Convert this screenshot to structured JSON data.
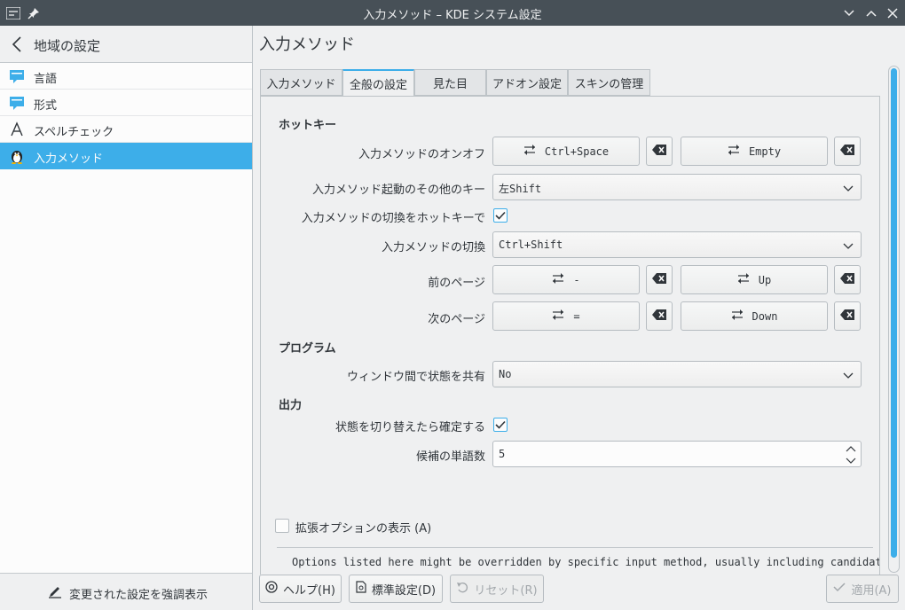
{
  "window": {
    "title": "入力メソッド – KDE システム設定"
  },
  "sidebar": {
    "header": "地域の設定",
    "items": [
      {
        "label": "言語",
        "icon": "speech-bubble-icon"
      },
      {
        "label": "形式",
        "icon": "speech-bubble-icon"
      },
      {
        "label": "スペルチェック",
        "icon": "letter-a-icon"
      },
      {
        "label": "入力メソッド",
        "icon": "penguin-icon",
        "selected": true
      }
    ],
    "footer": "変更された設定を強調表示"
  },
  "main": {
    "title": "入力メソッド",
    "tabs": [
      "入力メソッド",
      "全般の設定",
      "見た目",
      "アドオン設定",
      "スキンの管理"
    ],
    "active_tab": "全般の設定"
  },
  "hotkeys": {
    "section": "ホットキー",
    "toggle_label": "入力メソッドのオンオフ",
    "toggle_key1": "Ctrl+Space",
    "toggle_key2": "Empty",
    "extra_label": "入力メソッド起動のその他のキー",
    "extra_value": "左Shift",
    "switch_check_label": "入力メソッドの切換をホットキーで",
    "switch_label": "入力メソッドの切換",
    "switch_value": "Ctrl+Shift",
    "prev_label": "前のページ",
    "prev_key1": "-",
    "prev_key2": "Up",
    "next_label": "次のページ",
    "next_key1": "=",
    "next_key2": "Down"
  },
  "program": {
    "section": "プログラム",
    "share_label": "ウィンドウ間で状態を共有",
    "share_value": "No"
  },
  "output": {
    "section": "出力",
    "commit_label": "状態を切り替えたら確定する",
    "candidates_label": "候補の単語数",
    "candidates_value": "5"
  },
  "advanced": {
    "label": "拡張オプションの表示 (A)",
    "note": "Options listed here might be overridden by specific input method, usually including candidate"
  },
  "buttons": {
    "help": "ヘルプ(H)",
    "defaults": "標準設定(D)",
    "reset": "リセット(R)",
    "apply": "適用(A)"
  },
  "colors": {
    "accent": "#3daee9",
    "titlebar": "#475057",
    "background": "#eff0f1"
  }
}
